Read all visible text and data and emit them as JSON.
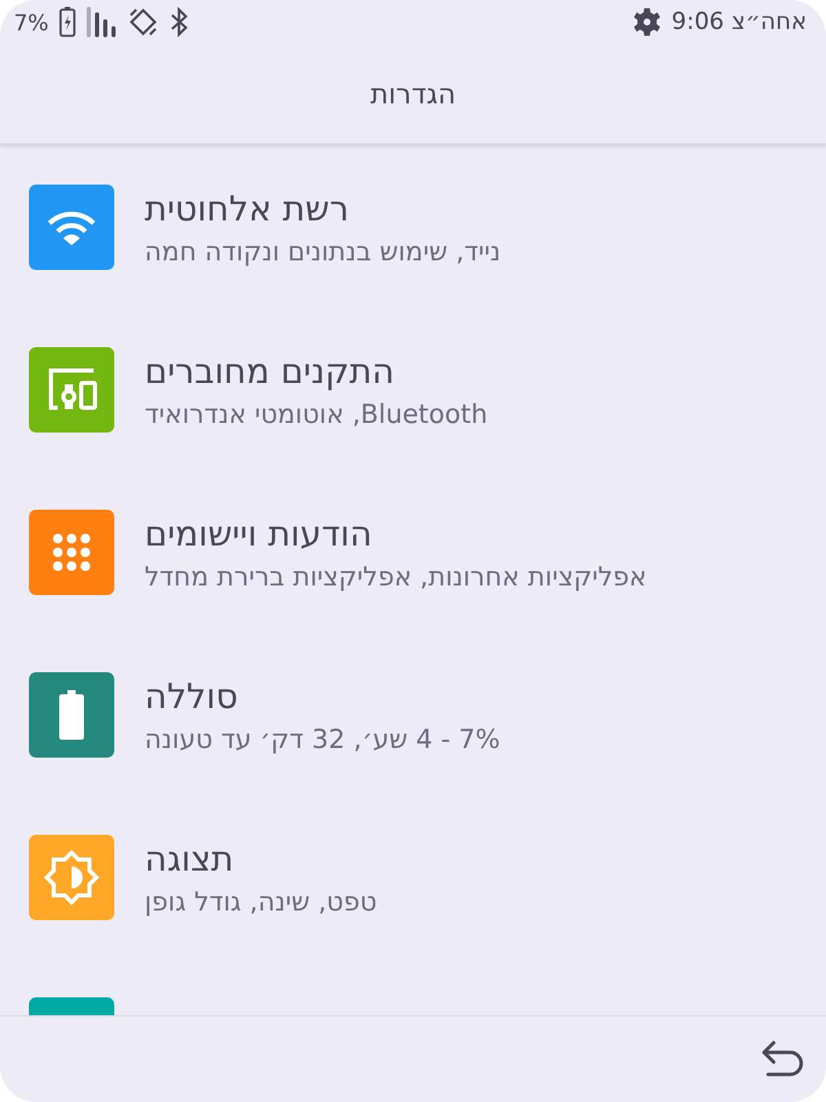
{
  "status_bar": {
    "battery_percent": "7%",
    "time": "אחה״צ 9:06"
  },
  "header": {
    "title": "הגדרות"
  },
  "items": [
    {
      "kind": "wifi",
      "color": "#2196f3",
      "title": "רשת אלחוטית",
      "subtitle": "נייד, שימוש בנתונים ונקודה חמה"
    },
    {
      "kind": "devices",
      "color": "#74b711",
      "title": "התקנים מחוברים",
      "subtitle": "Bluetooth, אוטומטי אנדרואיד"
    },
    {
      "kind": "apps",
      "color": "#ff7f11",
      "title": "הודעות ויישומים",
      "subtitle": "אפליקציות אחרונות, אפליקציות ברירת מחדל"
    },
    {
      "kind": "battery",
      "color": "#25897f",
      "title": "סוללה",
      "subtitle": "7% - 4 שע׳, 32 דק׳ עד טעונה"
    },
    {
      "kind": "display",
      "color": "#ffa726",
      "title": "תצוגה",
      "subtitle": "טפט, שינה, גודל גופן"
    },
    {
      "kind": "other",
      "color": "#00a9a5"
    }
  ]
}
